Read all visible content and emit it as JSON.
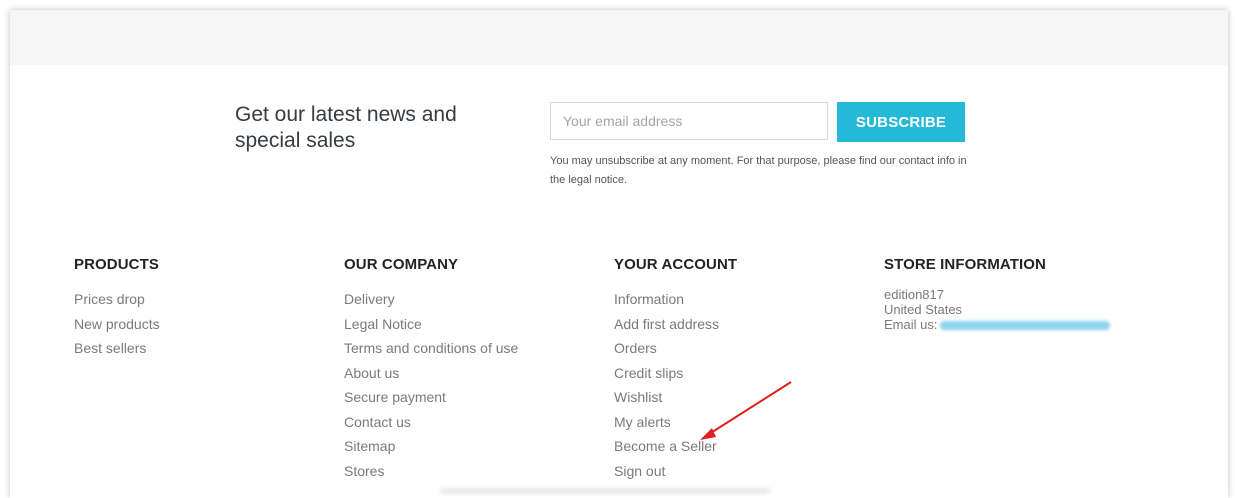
{
  "newsletter": {
    "title": "Get our latest news and special sales",
    "email_placeholder": "Your email address",
    "subscribe_label": "SUBSCRIBE",
    "legal_text": "You may unsubscribe at any moment. For that purpose, please find our contact info in the legal notice."
  },
  "footer": {
    "products": {
      "heading": "PRODUCTS",
      "links": [
        "Prices drop",
        "New products",
        "Best sellers"
      ]
    },
    "company": {
      "heading": "OUR COMPANY",
      "links": [
        "Delivery",
        "Legal Notice",
        "Terms and conditions of use",
        "About us",
        "Secure payment",
        "Contact us",
        "Sitemap",
        "Stores"
      ]
    },
    "account": {
      "heading": "YOUR ACCOUNT",
      "links": [
        "Information",
        "Add first address",
        "Orders",
        "Credit slips",
        "Wishlist",
        "My alerts",
        "Become a Seller",
        "Sign out"
      ]
    },
    "store": {
      "heading": "STORE INFORMATION",
      "name": "edition817",
      "country": "United States",
      "email_label": "Email us:"
    }
  },
  "colors": {
    "accent": "#24b9d7",
    "annotation_arrow": "#e02020"
  }
}
